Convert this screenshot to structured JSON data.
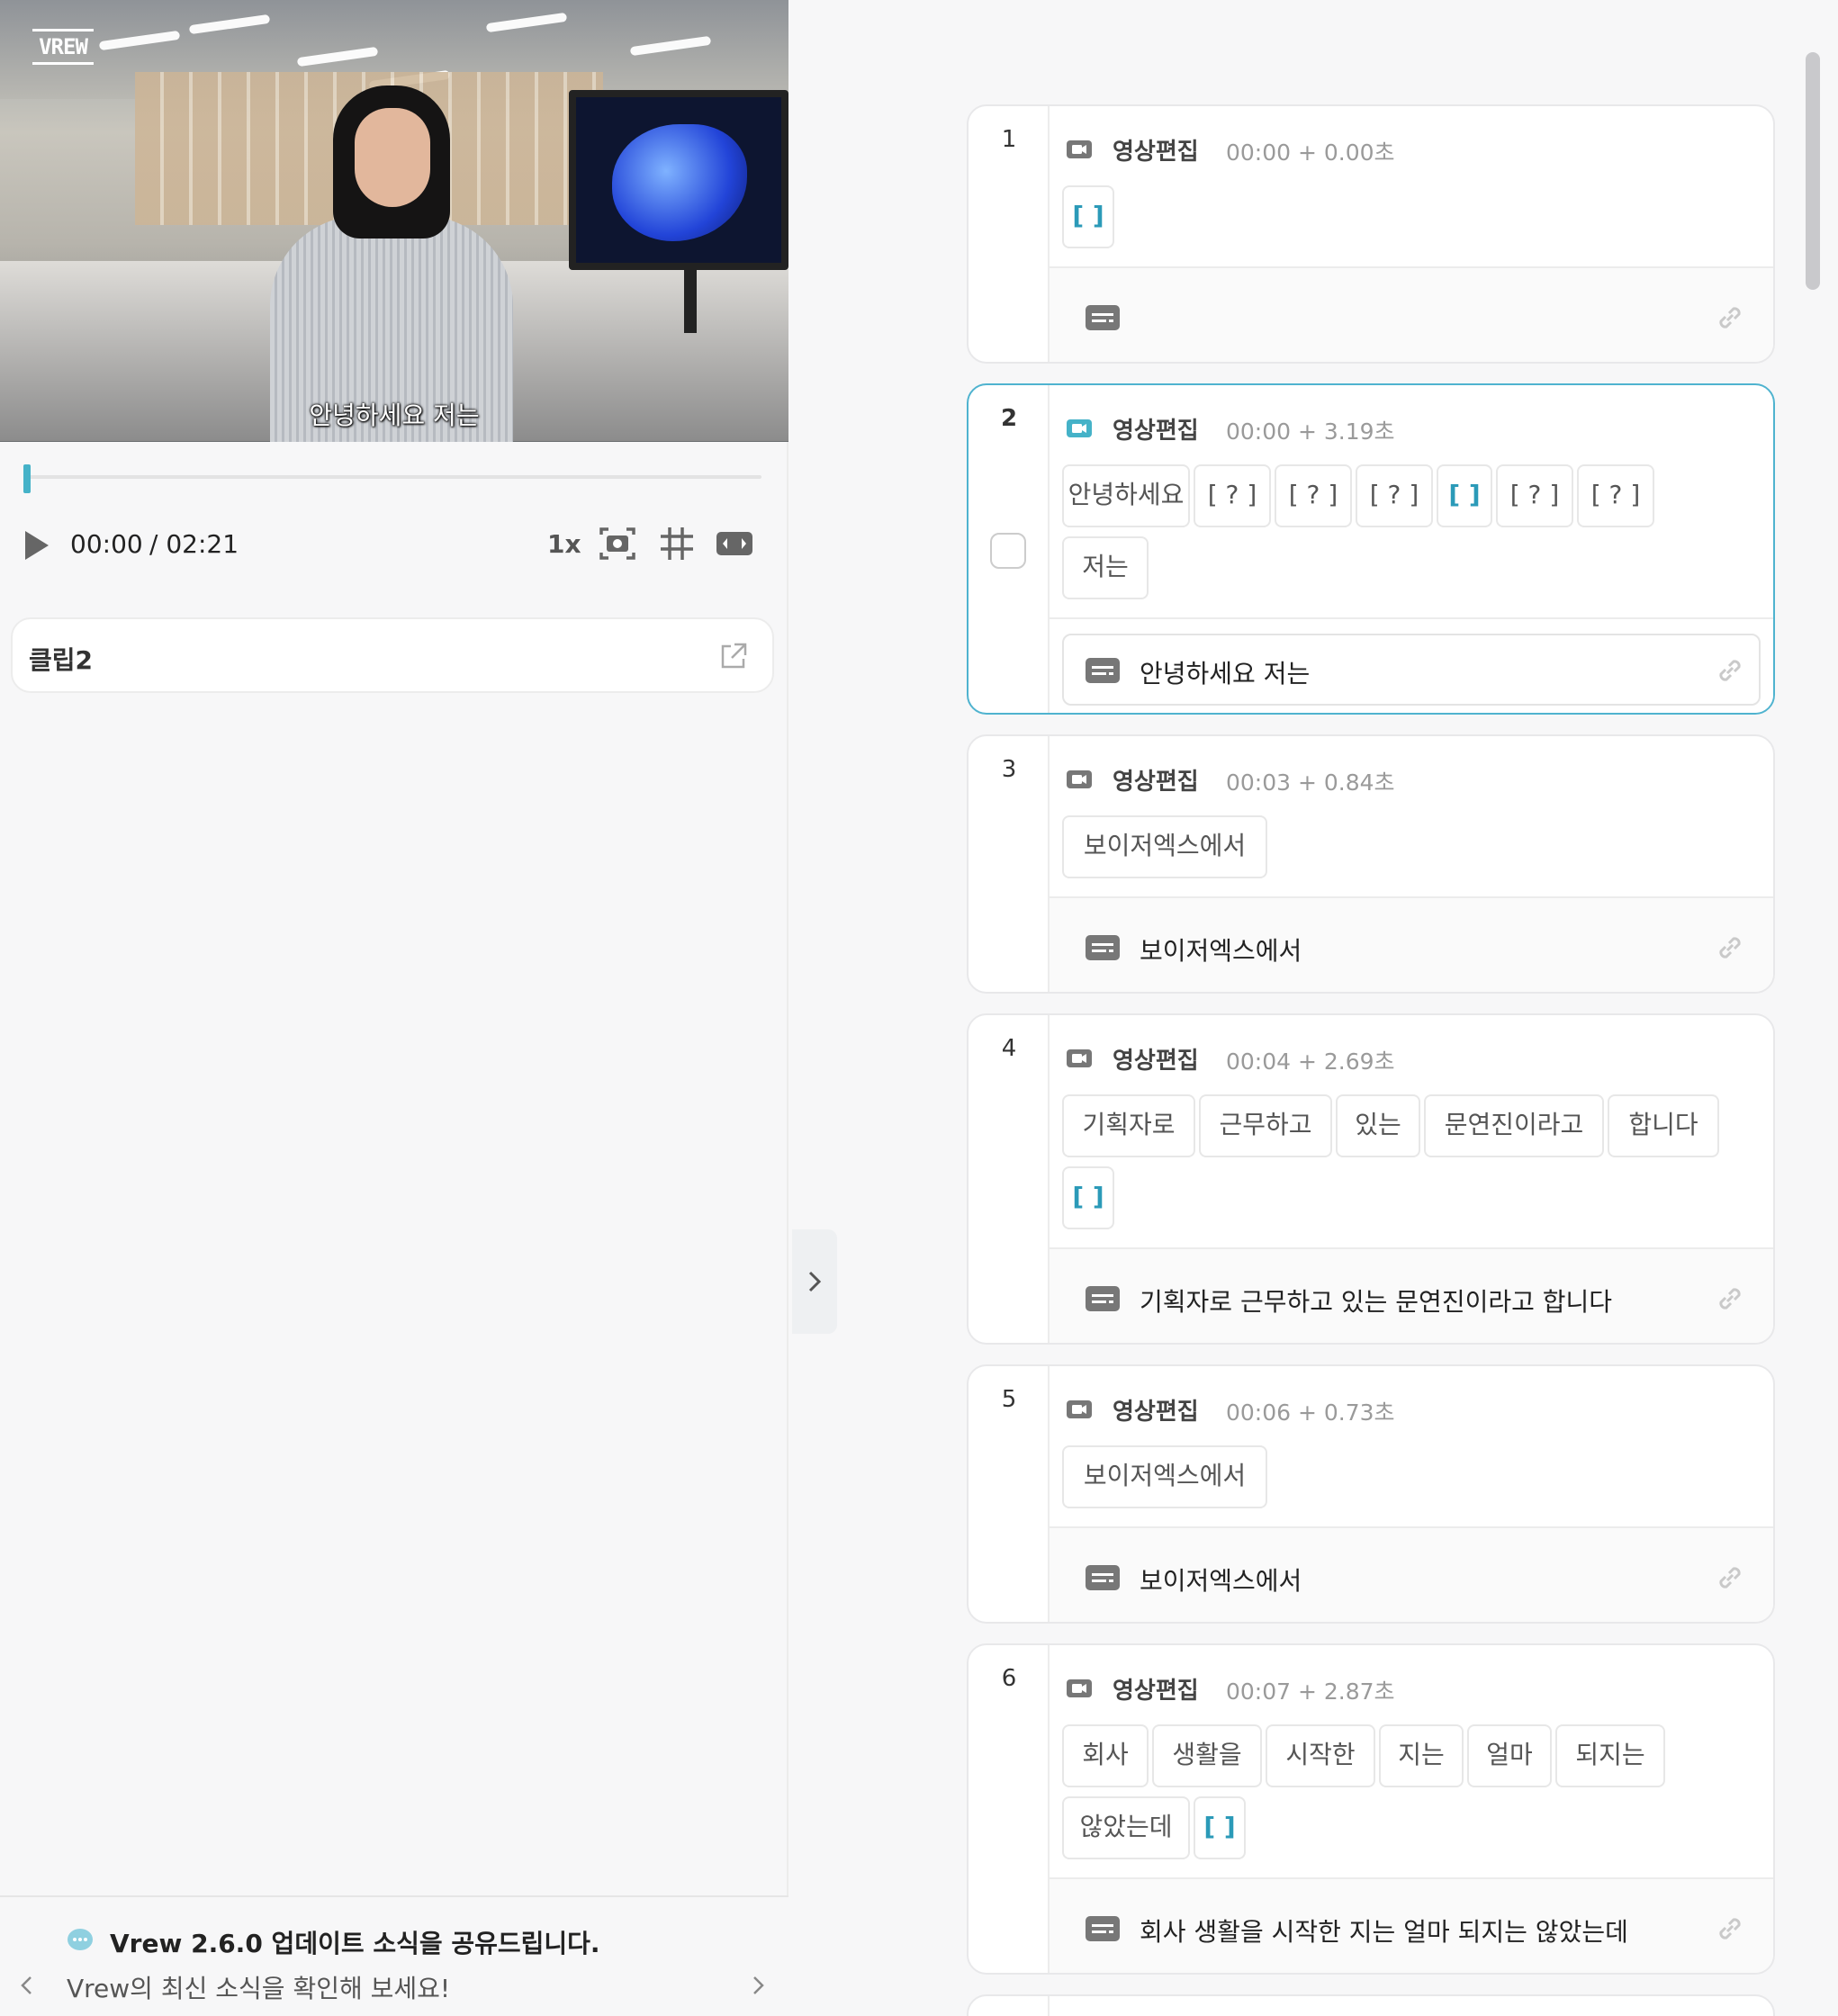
{
  "player": {
    "logo": "VREW",
    "subtitle": "안녕하세요 저는",
    "current_time": "00:00",
    "total_time": "/ 02:21",
    "speed": "1x"
  },
  "clip_panel": {
    "title": "클립2"
  },
  "news": {
    "title": "Vrew 2.6.0 업데이트 소식을 공유드립니다.",
    "subtitle": "Vrew의 최신 소식을 확인해 보세요!"
  },
  "colors": {
    "accent": "#45b2c8",
    "bracket": "#2b9ab8",
    "active_border": "#4fb3cf"
  },
  "clips": [
    {
      "num": "1",
      "title": "영상편집",
      "time": "00:00 + 0.00초",
      "words": [
        "[ ]"
      ],
      "subtitle": ""
    },
    {
      "num": "2",
      "title": "영상편집",
      "time": "00:00 + 3.19초",
      "words": [
        "안녕하세요",
        "[ ? ]",
        "[ ? ]",
        "[ ? ]",
        "[ ]",
        "[ ? ]",
        "[ ? ]",
        "저는"
      ],
      "subtitle": "안녕하세요 저는",
      "active": true
    },
    {
      "num": "3",
      "title": "영상편집",
      "time": "00:03 + 0.84초",
      "words": [
        "보이저엑스에서"
      ],
      "subtitle": "보이저엑스에서"
    },
    {
      "num": "4",
      "title": "영상편집",
      "time": "00:04 + 2.69초",
      "words": [
        "기획자로",
        "근무하고",
        "있는",
        "문연진이라고",
        "합니다",
        "[ ]"
      ],
      "subtitle": "기획자로 근무하고 있는 문연진이라고 합니다"
    },
    {
      "num": "5",
      "title": "영상편집",
      "time": "00:06 + 0.73초",
      "words": [
        "보이저엑스에서"
      ],
      "subtitle": "보이저엑스에서"
    },
    {
      "num": "6",
      "title": "영상편집",
      "time": "00:07 + 2.87초",
      "words": [
        "회사",
        "생활을",
        "시작한",
        "지는",
        "얼마",
        "되지는",
        "않았는데",
        "[ ]"
      ],
      "subtitle": "회사 생활을 시작한 지는 얼마 되지는 않았는데"
    }
  ]
}
